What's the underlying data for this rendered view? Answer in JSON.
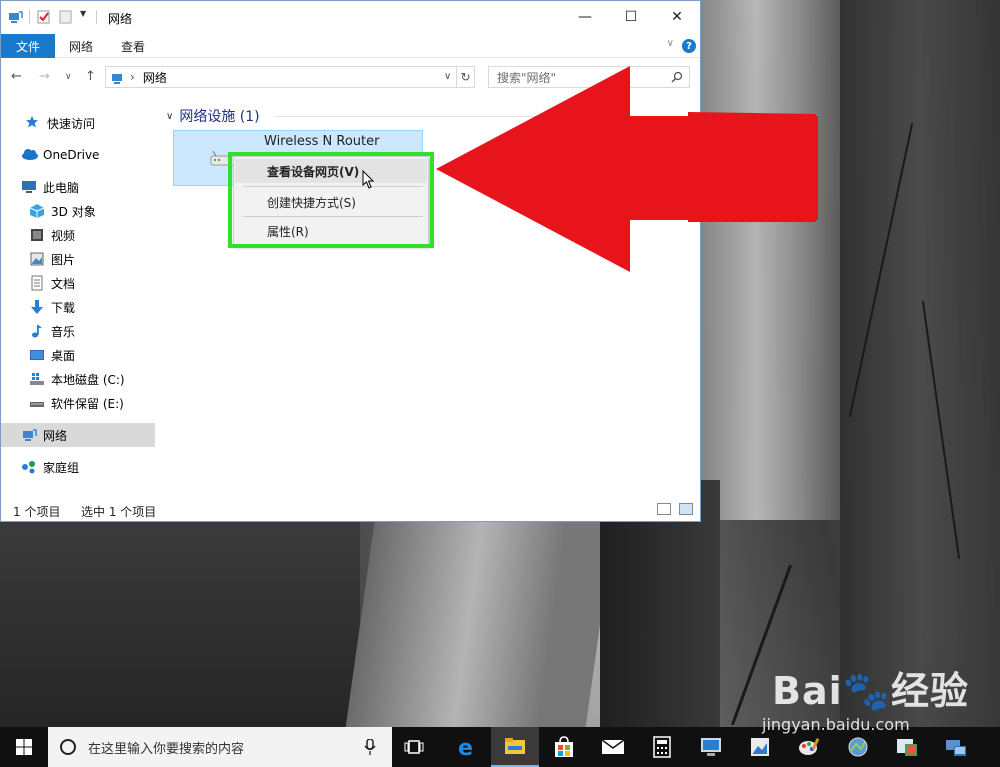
{
  "window": {
    "title": "网络",
    "minimize_glyph": "—",
    "maximize_glyph": "☐",
    "close_glyph": "✕"
  },
  "ribbon": {
    "tabs": [
      "文件",
      "网络",
      "查看"
    ],
    "help_glyph": "?",
    "chevron_glyph": "∨"
  },
  "address_bar": {
    "back_glyph": "←",
    "forward_glyph": "→",
    "recent_glyph": "∨",
    "up_glyph": "↑",
    "separator": "›",
    "path": "网络",
    "refresh_glyph": "↻",
    "search_placeholder": "搜索\"网络\""
  },
  "nav_pane": {
    "items": [
      {
        "label": "快速访问",
        "icon": "star-icon"
      },
      {
        "label": "OneDrive",
        "icon": "cloud-icon"
      },
      {
        "label": "此电脑",
        "icon": "computer-icon"
      },
      {
        "label": "3D 对象",
        "icon": "cube-icon"
      },
      {
        "label": "视频",
        "icon": "video-icon"
      },
      {
        "label": "图片",
        "icon": "picture-icon"
      },
      {
        "label": "文档",
        "icon": "document-icon"
      },
      {
        "label": "下载",
        "icon": "download-icon"
      },
      {
        "label": "音乐",
        "icon": "music-icon"
      },
      {
        "label": "桌面",
        "icon": "desktop-icon"
      },
      {
        "label": "本地磁盘 (C:)",
        "icon": "drive-icon"
      },
      {
        "label": "软件保留 (E:)",
        "icon": "drive-icon"
      },
      {
        "label": "网络",
        "icon": "network-icon"
      },
      {
        "label": "家庭组",
        "icon": "homegroup-icon"
      }
    ]
  },
  "content": {
    "group_header": "网络设施 (1)",
    "device_name": "Wireless N Router"
  },
  "context_menu": {
    "items": [
      "查看设备网页(V)",
      "创建快捷方式(S)",
      "属性(R)"
    ]
  },
  "status_bar": {
    "count": "1 个项目",
    "selected": "选中 1 个项目"
  },
  "taskbar": {
    "search_placeholder": "在这里输入你要搜索的内容",
    "apps": [
      "task-view",
      "edge",
      "file-explorer",
      "store",
      "mail",
      "calculator",
      "remote-desktop",
      "image-viewer",
      "paint",
      "control-panel",
      "photos",
      "network-connections"
    ]
  },
  "watermark": {
    "logo": "Bai🐾经验",
    "url": "jingyan.baidu.com"
  },
  "colors": {
    "accent": "#1979ca",
    "selection": "#cce8ff",
    "highlight_box": "#2ee12a",
    "arrow": "#e8141c"
  }
}
